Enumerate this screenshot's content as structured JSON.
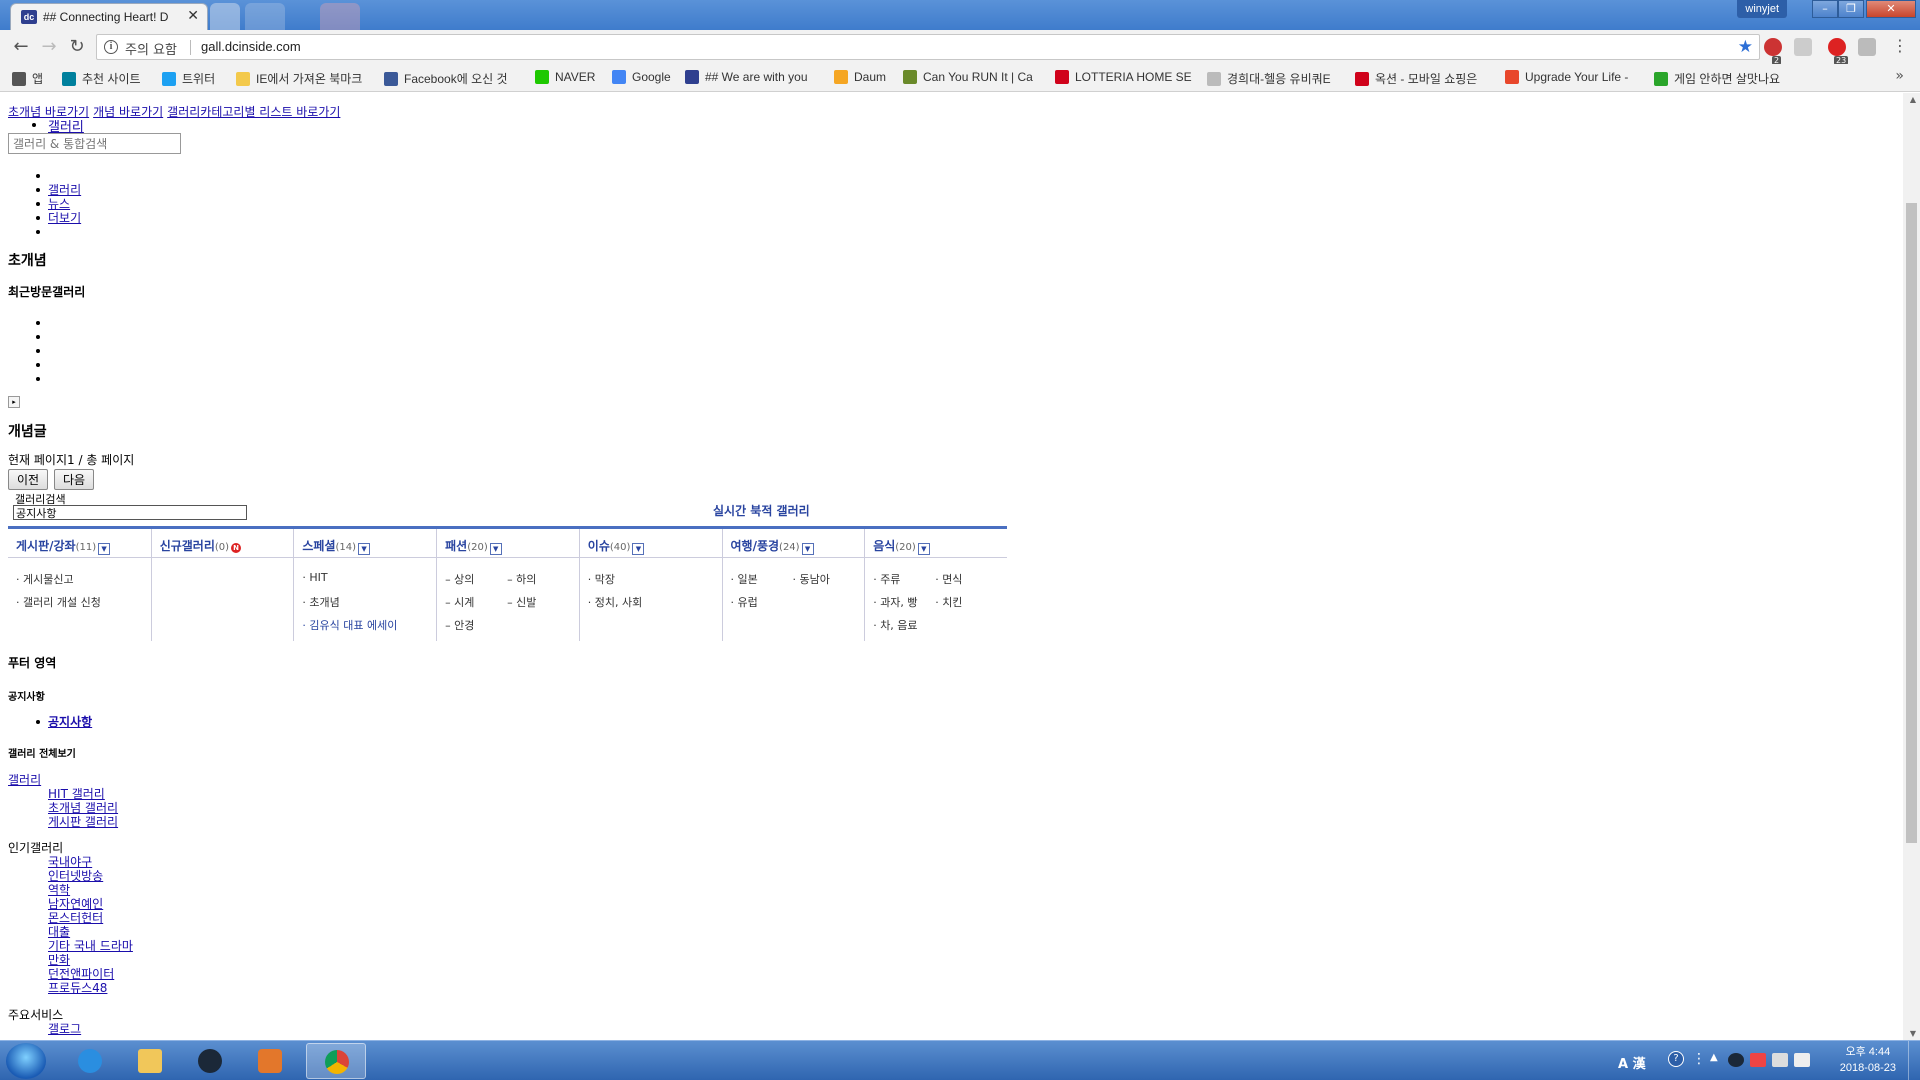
{
  "browser": {
    "tab_title": "## Connecting Heart! D",
    "tab_favicon": "dc",
    "window_user": "winyjet",
    "url": "gall.dcinside.com",
    "security_warning": "주의 요함",
    "bookmarks": [
      {
        "label": "앱",
        "icon": "apps-icon",
        "color": "#555555"
      },
      {
        "label": "추천 사이트",
        "icon": "bing-icon",
        "color": "#00809d"
      },
      {
        "label": "트위터",
        "icon": "twitter-icon",
        "color": "#1da1f2"
      },
      {
        "label": "IE에서 가져온 북마크",
        "icon": "folder-icon",
        "color": "#f3c94b"
      },
      {
        "label": "Facebook에 오신 것",
        "icon": "facebook-icon",
        "color": "#3b5998"
      },
      {
        "label": "NAVER",
        "icon": "naver-icon",
        "color": "#1ec800"
      },
      {
        "label": "Google",
        "icon": "google-icon",
        "color": "#4285f4"
      },
      {
        "label": "## We are with you",
        "icon": "dc-icon",
        "color": "#2f3f8f"
      },
      {
        "label": "Daum",
        "icon": "daum-icon",
        "color": "#f5a623"
      },
      {
        "label": "Can You RUN It | Ca",
        "icon": "cyri-icon",
        "color": "#6a8a2a"
      },
      {
        "label": "LOTTERIA HOME SE",
        "icon": "lotteria-icon",
        "color": "#d0021b"
      },
      {
        "label": "경희대-헬응 유비쿼E",
        "icon": "page-icon",
        "color": "#bbbbbb"
      },
      {
        "label": "옥션 - 모바일 쇼핑은",
        "icon": "auction-icon",
        "color": "#d0021b"
      },
      {
        "label": "Upgrade Your Life -",
        "icon": "upgrade-icon",
        "color": "#e8472b"
      },
      {
        "label": "게임 안하면 살맛나요",
        "icon": "game-icon",
        "color": "#2aa52a"
      }
    ]
  },
  "page": {
    "top_links": [
      "초개념 바로가기",
      "개념 바로가기",
      "갤러리카테고리별 리스트 바로가기"
    ],
    "gallery_link": "갤러리",
    "search_placeholder": "갤러리 & 통합검색",
    "nav_links": [
      "갤러리",
      "뉴스",
      "더보기"
    ],
    "heading_chogaenyeom": "초개념",
    "heading_recent": "최근방문갤러리",
    "heading_gaenyeomgeul": "개념글",
    "current_page_text": "현재 페이지1 / 총 페이지",
    "prev_label": "이전",
    "next_label": "다음",
    "gallery_search_label": "갤러리검색",
    "gallery_search_value": "공지사항",
    "realtime_title": "실시간 북적 갤러리",
    "categories": [
      {
        "name": "게시판/강좌",
        "count": "(11)",
        "items": [
          "게시물신고",
          "갤러리 개설 신청"
        ]
      },
      {
        "name": "신규갤러리",
        "count": "(0)",
        "items": []
      },
      {
        "name": "스페셜",
        "count": "(14)",
        "items": [
          "HIT",
          "초개념",
          "김유식 대표 에세이"
        ]
      },
      {
        "name": "패션",
        "count": "(20)",
        "items": [
          "상의",
          "하의",
          "시계",
          "신발",
          "안경"
        ]
      },
      {
        "name": "이슈",
        "count": "(40)",
        "items": [
          "막장",
          "정치, 사회"
        ]
      },
      {
        "name": "여행/풍경",
        "count": "(24)",
        "items": [
          "일본",
          "동남아",
          "유럽"
        ]
      },
      {
        "name": "음식",
        "count": "(20)",
        "items": [
          "주류",
          "면식",
          "과자, 빵",
          "치킨",
          "차, 음료"
        ]
      }
    ],
    "new_badge": "N",
    "footer_heading": "푸터 영역",
    "notice_heading": "공지사항",
    "notice_link": "공지사항",
    "all_gallery_heading": "갤러리 전체보기",
    "gallery_root_link": "갤러리",
    "gallery_sub_links": [
      "HIT 갤러리",
      "초개념 갤러리",
      "게시판 갤러리"
    ],
    "popular_heading": "인기갤러리",
    "popular_links": [
      "국내야구",
      "인터넷방송",
      "역학",
      "남자연예인",
      "몬스터헌터",
      "대출",
      "기타 국내 드라마",
      "만화",
      "던전앤파이터",
      "프로듀스48"
    ],
    "main_services_heading": "주요서비스",
    "main_services_links": [
      "갤로그"
    ]
  },
  "taskbar": {
    "time": "오후 4:44",
    "date": "2018-08-23",
    "ime_label": "A 漢"
  }
}
